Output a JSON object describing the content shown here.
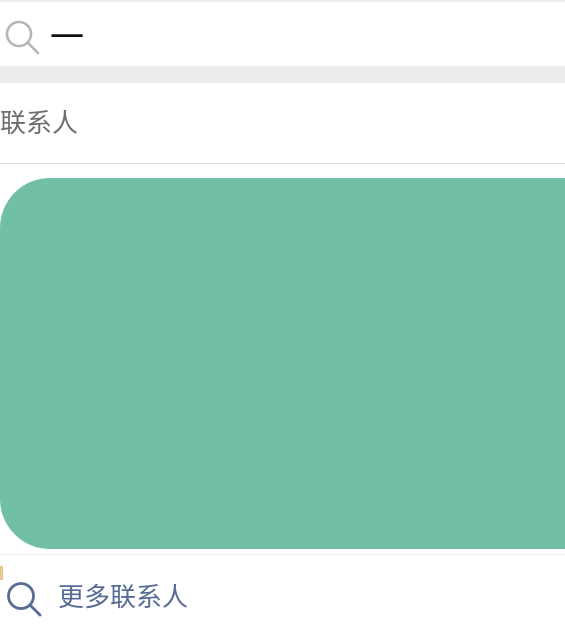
{
  "search": {
    "value": "一",
    "icon": "search-icon"
  },
  "section": {
    "title": "联系人"
  },
  "more": {
    "label": "更多联系人",
    "icon": "search-icon"
  },
  "colors": {
    "background": "#ffffff",
    "band": "#ededed",
    "card": "#72bfa8",
    "link": "#576b95",
    "section_text": "#6e6e6e",
    "icon_gray": "#b5b5b5"
  }
}
